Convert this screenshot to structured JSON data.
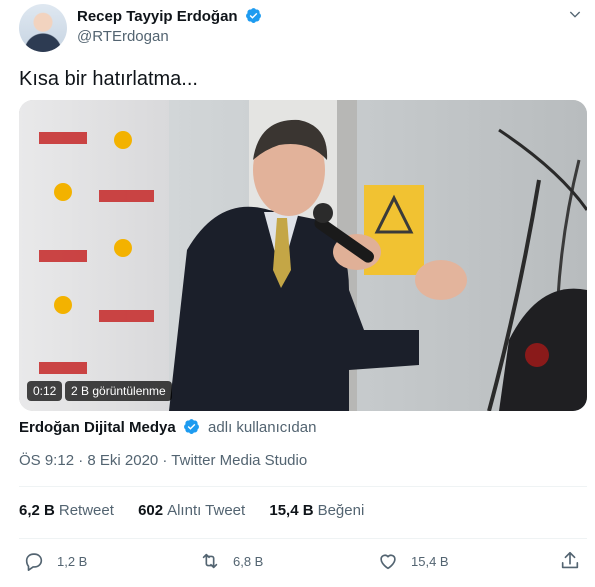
{
  "author": {
    "name": "Recep Tayyip Erdoğan",
    "handle": "@RTErdogan"
  },
  "tweet": {
    "text": "Kısa bir hatırlatma..."
  },
  "video": {
    "duration": "0:12",
    "views": "2 B görüntülenme"
  },
  "source": {
    "name": "Erdoğan Dijital Medya",
    "suffix": "adlı kullanıcıdan"
  },
  "meta": {
    "time": "ÖS 9:12 · 8 Eki 2020 · Twitter Media Studio"
  },
  "stats": [
    {
      "value": "6,2 B",
      "label": "Retweet"
    },
    {
      "value": "602",
      "label": "Alıntı Tweet"
    },
    {
      "value": "15,4 B",
      "label": "Beğeni"
    }
  ],
  "actions": {
    "reply_count": "1,2 B",
    "retweet_count": "6,8 B",
    "like_count": "15,4 B"
  },
  "colors": {
    "verified": "#1d9bf0",
    "secondary_text": "#536471",
    "primary_text": "#0f1419"
  },
  "icons": [
    "verified-icon",
    "caret-down-icon",
    "reply-icon",
    "retweet-icon",
    "like-icon",
    "share-icon"
  ]
}
